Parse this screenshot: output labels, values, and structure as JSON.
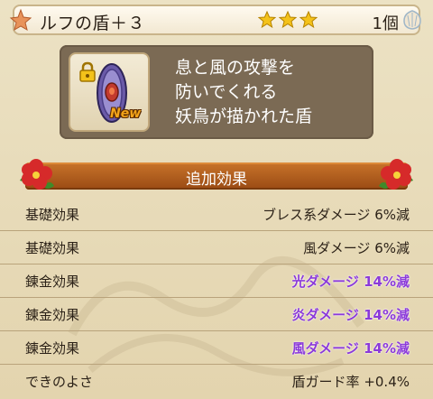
{
  "header": {
    "item_name": "ルフの盾＋３",
    "rarity_stars": 3,
    "count": "1個"
  },
  "item": {
    "icon": "round-shield-icon",
    "locked": true,
    "badge": "New",
    "description_lines": [
      "息と風の攻撃を",
      "防いでくれる",
      "妖鳥が描かれた盾"
    ]
  },
  "effects": {
    "title": "追加効果",
    "rows": [
      {
        "label": "基礎効果",
        "value": "ブレス系ダメージ  6%減",
        "type": "base"
      },
      {
        "label": "基礎効果",
        "value": "風ダメージ  6%減",
        "type": "base"
      },
      {
        "label": "錬金効果",
        "value": "光ダメージ  14%減",
        "type": "alchemy"
      },
      {
        "label": "錬金効果",
        "value": "炎ダメージ  14%減",
        "type": "alchemy"
      },
      {
        "label": "錬金効果",
        "value": "風ダメージ  14%減",
        "type": "alchemy"
      },
      {
        "label": "できのよさ",
        "value": "盾ガード率  +0.4%",
        "type": "base"
      }
    ]
  },
  "colors": {
    "background": "#e7dab7",
    "panel": "#7b6a54",
    "banner": "#b45e1f",
    "alchemy_text": "#8b3ad9",
    "star": "#f4c21a"
  }
}
